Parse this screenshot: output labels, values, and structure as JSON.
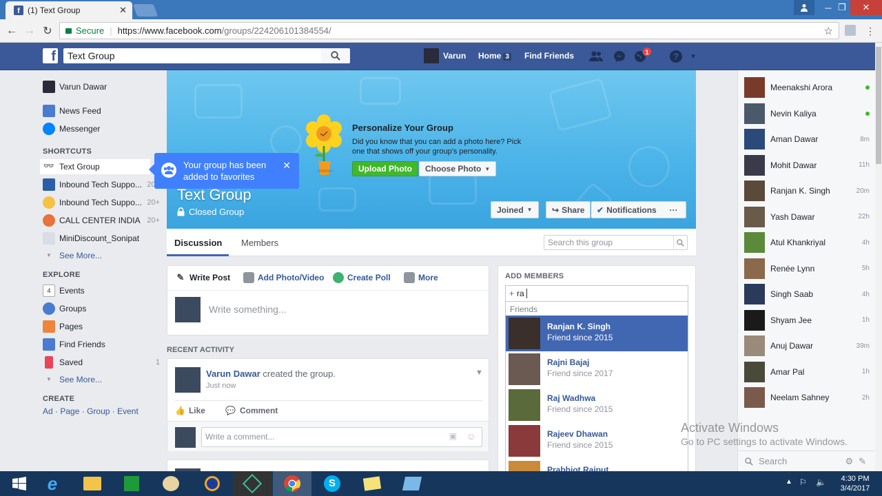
{
  "browser": {
    "tab_title": "(1) Text Group",
    "secure_label": "Secure",
    "url_host": "https://www.facebook.com",
    "url_path": "/groups/224206101384554/"
  },
  "fb_header": {
    "search_value": "Text Group",
    "user_name": "Varun",
    "home_label": "Home",
    "home_count": "3",
    "find_friends": "Find Friends",
    "notif_count": "1"
  },
  "left_nav": {
    "profile_name": "Varun Dawar",
    "items": [
      {
        "label": "News Feed"
      },
      {
        "label": "Messenger"
      }
    ],
    "shortcuts_header": "SHORTCUTS",
    "shortcuts": [
      {
        "label": "Text Group",
        "count": ""
      },
      {
        "label": "Inbound Tech Suppo...",
        "count": "20+"
      },
      {
        "label": "Inbound Tech Suppo...",
        "count": "20+"
      },
      {
        "label": "CALL CENTER INDIA",
        "count": "20+"
      },
      {
        "label": "MiniDiscount_Sonipat",
        "count": ""
      }
    ],
    "see_more": "See More...",
    "explore_header": "EXPLORE",
    "explore": [
      {
        "label": "Events",
        "count": ""
      },
      {
        "label": "Groups",
        "count": ""
      },
      {
        "label": "Pages",
        "count": ""
      },
      {
        "label": "Find Friends",
        "count": ""
      },
      {
        "label": "Saved",
        "count": "1"
      }
    ],
    "events_day": "4",
    "create_header": "CREATE",
    "create_links": [
      "Ad",
      "Page",
      "Group",
      "Event"
    ]
  },
  "tooltip": {
    "text": "Your group has been added to favorites"
  },
  "cover": {
    "title": "Personalize Your Group",
    "desc": "Did you know that you can add a photo here? Pick one that shows off your group's personality.",
    "upload_btn": "Upload Photo",
    "choose_btn": "Choose Photo",
    "group_name": "Text Group",
    "group_type": "Closed Group",
    "joined_btn": "Joined",
    "share_btn": "Share",
    "notif_btn": "Notifications",
    "more_btn": "···"
  },
  "tabs": {
    "discussion": "Discussion",
    "members": "Members",
    "search_placeholder": "Search this group"
  },
  "composer": {
    "write_post": "Write Post",
    "add_photo": "Add Photo/Video",
    "create_poll": "Create Poll",
    "more": "More",
    "placeholder": "Write something..."
  },
  "recent": {
    "header": "RECENT ACTIVITY",
    "author": "Varun Dawar",
    "action": "created the group.",
    "time": "Just now",
    "like": "Like",
    "comment": "Comment",
    "comment_placeholder": "Write a comment..."
  },
  "add_members": {
    "header": "ADD MEMBERS",
    "input_value": "ra",
    "friends_header": "Friends",
    "suggestions": [
      {
        "name": "Ranjan K. Singh",
        "since": "Friend since 2015",
        "color": "#3a2f2a"
      },
      {
        "name": "Rajni Bajaj",
        "since": "Friend since 2017",
        "color": "#6b5a52"
      },
      {
        "name": "Raj Wadhwa",
        "since": "Friend since 2015",
        "color": "#5a6a3a"
      },
      {
        "name": "Rajeev Dhawan",
        "since": "Friend since 2015",
        "color": "#8a3a3a"
      },
      {
        "name": "Prabhjot Rajput",
        "since": "",
        "color": "#c98a3a"
      }
    ]
  },
  "chat": {
    "contacts": [
      {
        "name": "Meenakshi Arora",
        "time": "",
        "online": true,
        "color": "#7a3a2a"
      },
      {
        "name": "Nevin Kaliya",
        "time": "",
        "online": true,
        "color": "#4a5a6a"
      },
      {
        "name": "Aman Dawar",
        "time": "8m",
        "online": false,
        "color": "#2a4a7a"
      },
      {
        "name": "Mohit Dawar",
        "time": "11h",
        "online": false,
        "color": "#3a3a4a"
      },
      {
        "name": "Ranjan K. Singh",
        "time": "20m",
        "online": false,
        "color": "#5a4a3a"
      },
      {
        "name": "Yash Dawar",
        "time": "22h",
        "online": false,
        "color": "#6a5a4a"
      },
      {
        "name": "Atul Khankriyal",
        "time": "4h",
        "online": false,
        "color": "#5a8a3a"
      },
      {
        "name": "Renée Lynn",
        "time": "5h",
        "online": false,
        "color": "#8a6a4a"
      },
      {
        "name": "Singh Saab",
        "time": "4h",
        "online": false,
        "color": "#2a3a5a"
      },
      {
        "name": "Shyam Jee",
        "time": "1h",
        "online": false,
        "color": "#1a1a1a"
      },
      {
        "name": "Anuj Dawar",
        "time": "39m",
        "online": false,
        "color": "#9a8a7a"
      },
      {
        "name": "Amar Pal",
        "time": "1h",
        "online": false,
        "color": "#4a4a3a"
      },
      {
        "name": "Neelam Sahney",
        "time": "2h",
        "online": false,
        "color": "#7a5a4a"
      }
    ],
    "search_placeholder": "Search"
  },
  "watermark": {
    "line1": "Activate Windows",
    "line2": "Go to PC settings to activate Windows."
  },
  "taskbar": {
    "time": "4:30 PM",
    "date": "3/4/2017"
  },
  "colors": {
    "fb_blue": "#3b5998",
    "link": "#365899",
    "green": "#42b72a",
    "tooltip": "#4080ff"
  }
}
